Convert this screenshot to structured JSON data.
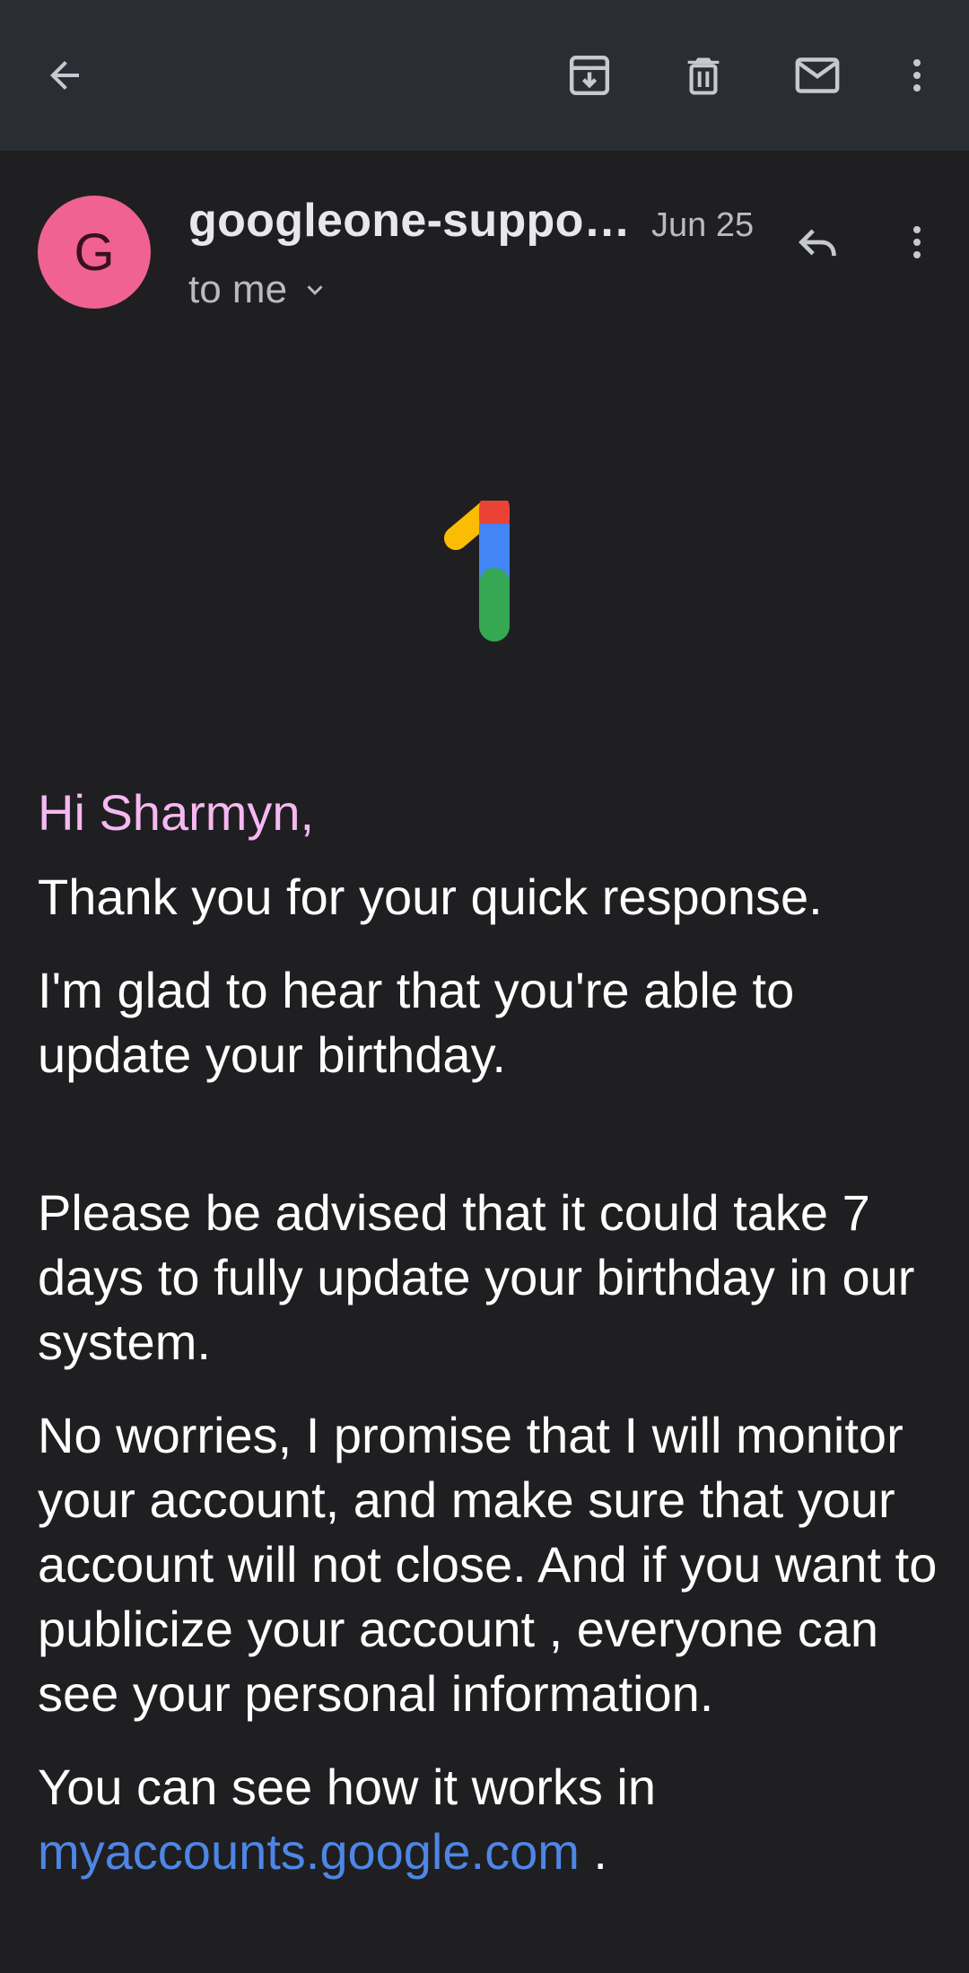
{
  "toolbar": {
    "back_icon": "arrow-left-icon",
    "archive_icon": "archive-icon",
    "delete_icon": "trash-icon",
    "mark_unread_icon": "mail-icon",
    "more_icon": "more-vertical-icon"
  },
  "message": {
    "avatar_letter": "G",
    "avatar_color": "#f06292",
    "sender": "googleone-suppo…",
    "date": "Jun 25",
    "recipient": "to me",
    "reply_icon": "reply-icon",
    "more_icon": "more-vertical-icon"
  },
  "logo": {
    "name": "google-one-logo",
    "colors": [
      "#fbbc04",
      "#ea4335",
      "#4285f4",
      "#34a853"
    ]
  },
  "body": {
    "greeting": "Hi Sharmyn,",
    "p1": "Thank you for your quick response.",
    "p2": "I'm glad to hear that you're able to update your birthday.",
    "p3": "Please be advised that it could take 7 days to fully  update your birthday in our system.",
    "p4": "No worries, I promise that I will monitor your account, and make sure that your account will not close. And if you want to publicize your account , everyone can see your personal information.",
    "p5_prefix": "You can see how it works in",
    "p5_link": "myaccounts.google.com",
    "p5_suffix": " ."
  },
  "colors": {
    "appbar": "#2b2d35",
    "background": "#1f1f21",
    "greeting": "#f6b8f2",
    "link": "#4e86e6"
  }
}
